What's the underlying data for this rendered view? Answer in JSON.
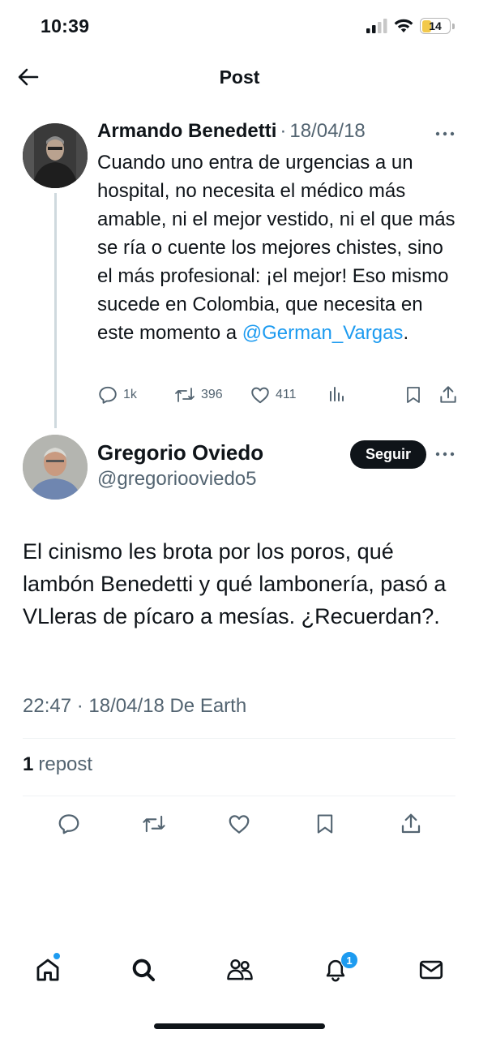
{
  "status_bar": {
    "time": "10:39",
    "battery": "14"
  },
  "header": {
    "title": "Post"
  },
  "parent_tweet": {
    "author_name": "Armando Benedetti",
    "separator": "·",
    "date": "18/04/18",
    "text_before": "Cuando uno entra de urgencias a un hospital, no necesita el médico más amable, ni el mejor vestido, ni el que más se ría o cuente los mejores chistes, sino el más profesional: ¡el mejor! Eso mismo sucede en Colombia, que necesita en este momento a ",
    "mention": "@German_Vargas",
    "text_after": ".",
    "replies": "1k",
    "reposts": "396",
    "likes": "411"
  },
  "main_tweet": {
    "author_name": "Gregorio Oviedo",
    "handle": "@gregoriooviedo5",
    "follow_label": "Seguir",
    "text": "El cinismo les brota por los poros, qué lambón Benedetti y qué lambonería, pasó a VLleras de pícaro a mesías. ¿Recuerdan?.",
    "meta": "22:47 · 18/04/18 De Earth",
    "repost_count": "1",
    "repost_label": "repost"
  },
  "bottom_nav": {
    "items": [
      "home-icon",
      "search-icon",
      "communities-icon",
      "notifications-icon",
      "messages-icon"
    ],
    "notifications_badge": "1"
  },
  "colors": {
    "accent": "#1d9bf0",
    "text": "#0f1419",
    "secondary": "#536471",
    "divider": "#eff3f4"
  }
}
